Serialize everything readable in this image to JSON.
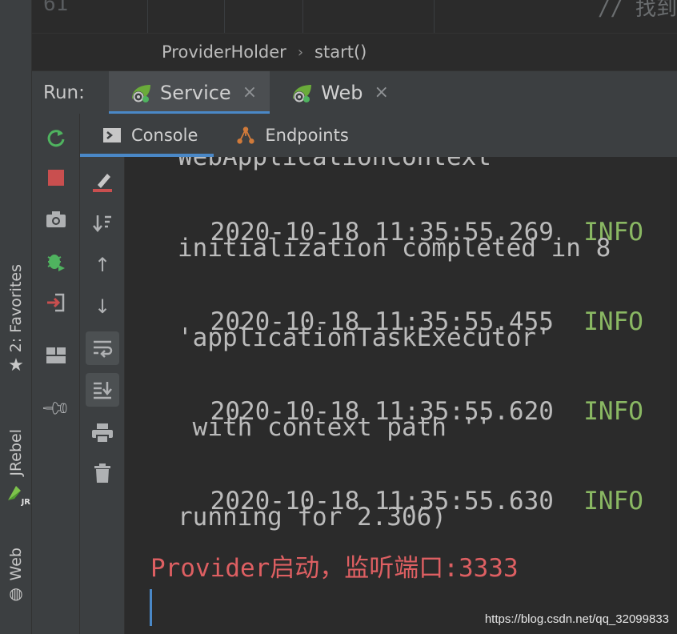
{
  "editor": {
    "line_number": "61",
    "comment_text": "// 找到"
  },
  "breadcrumb": {
    "class_name": "ProviderHolder",
    "method_name": "start()"
  },
  "run_bar": {
    "label": "Run:",
    "tabs": [
      {
        "label": "Service",
        "active": true
      },
      {
        "label": "Web",
        "active": false
      }
    ],
    "close_glyph": "×"
  },
  "left_strip": {
    "favorites_label": "2: Favorites",
    "jrebel_label": "JRebel",
    "jrebel_badge": "JR",
    "web_label": "Web"
  },
  "console_tabs": {
    "console_label": "Console",
    "endpoints_label": "Endpoints"
  },
  "console": {
    "partial_top": "WebApplicationContext",
    "lines": [
      {
        "time": "2020-10-18 11:35:55.269",
        "level": "INFO",
        "continuation": "initialization completed in 8"
      },
      {
        "time": "2020-10-18 11:35:55.455",
        "level": "INFO",
        "continuation": "'applicationTaskExecutor'"
      },
      {
        "time": "2020-10-18 11:35:55.620",
        "level": "INFO",
        "continuation": " with context path ''"
      },
      {
        "time": "2020-10-18 11:35:55.630",
        "level": "INFO",
        "continuation": "running for 2.306)"
      }
    ],
    "highlight_line": "Provider启动，监听端口:3333"
  },
  "colors": {
    "accent": "#4a88c7",
    "info": "#8ab863",
    "error_text": "#dd5f62",
    "rerun_green": "#4fb35f",
    "stop_red": "#c94f4f"
  },
  "watermark": "https://blog.csdn.net/qq_32099833"
}
